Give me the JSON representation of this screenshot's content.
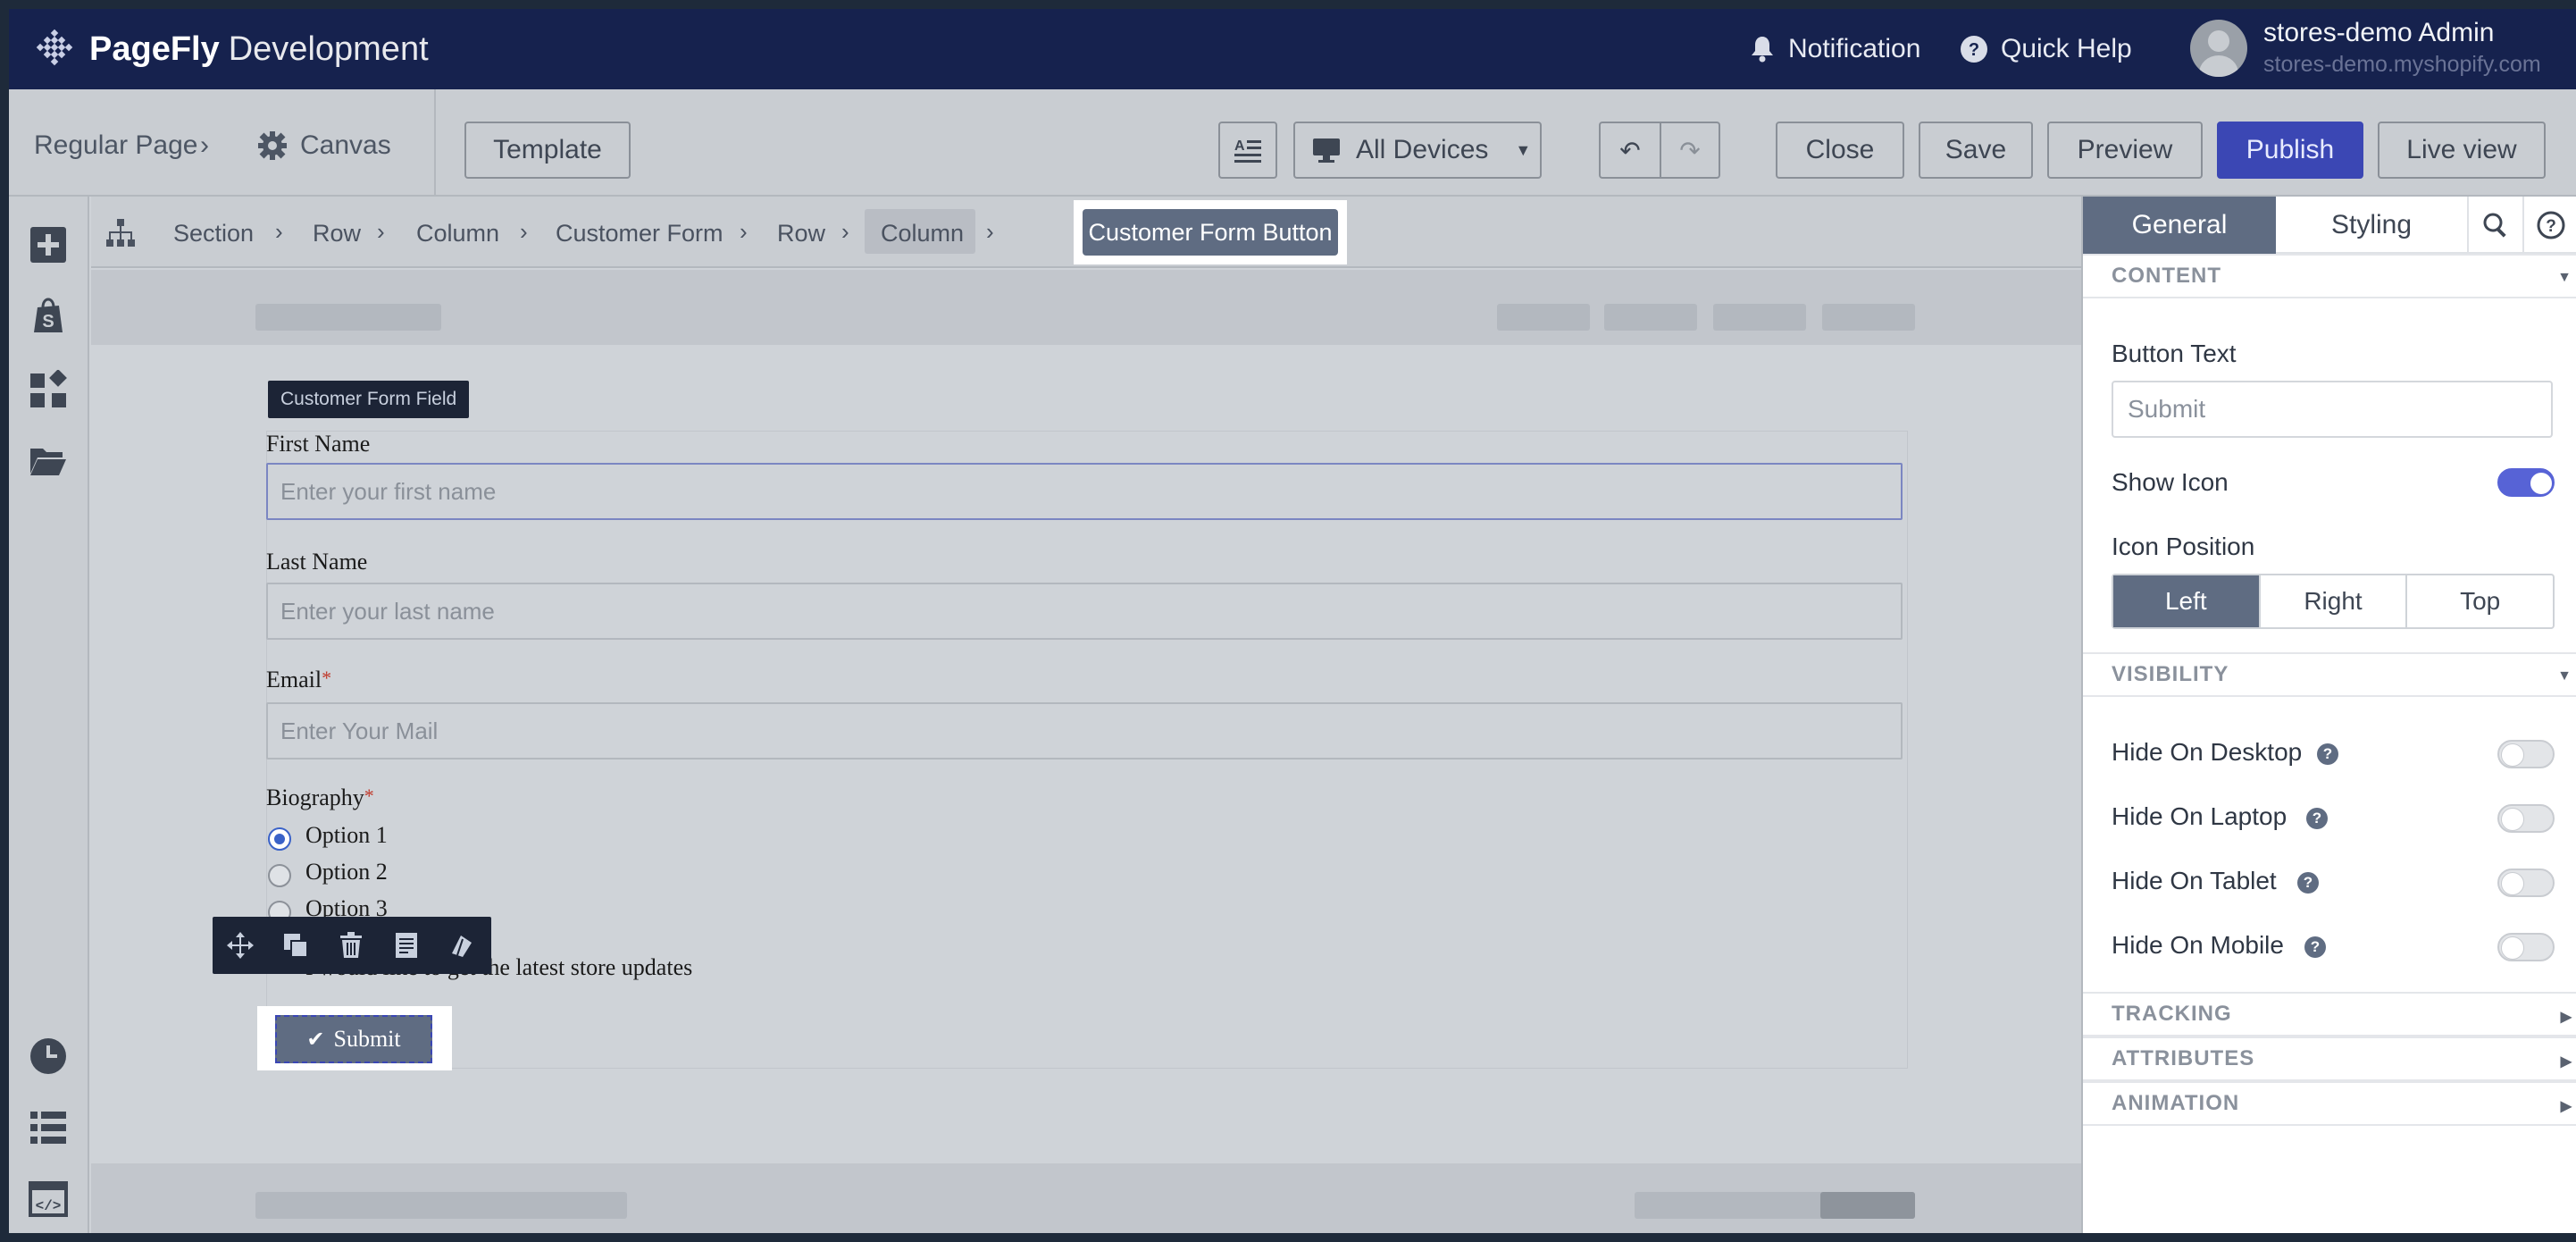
{
  "app": {
    "brand": "PageFly",
    "brand_suffix": "Development"
  },
  "topbar": {
    "notification_label": "Notification",
    "quick_help_label": "Quick Help",
    "user_name": "stores-demo Admin",
    "user_shop": "stores-demo.myshopify.com"
  },
  "toolbar": {
    "page_type": "Regular Page",
    "canvas_label": "Canvas",
    "template_label": "Template",
    "device_label": "All Devices",
    "close_label": "Close",
    "save_label": "Save",
    "preview_label": "Preview",
    "publish_label": "Publish",
    "live_view_label": "Live view"
  },
  "breadcrumb": {
    "items": [
      "Section",
      "Row",
      "Column",
      "Customer Form",
      "Row",
      "Column"
    ],
    "current": "Customer Form Button"
  },
  "form": {
    "tag_label": "Customer Form Field",
    "first_name_label": "First Name",
    "first_name_placeholder": "Enter your first name",
    "last_name_label": "Last Name",
    "last_name_placeholder": "Enter your last name",
    "email_label": "Email",
    "email_placeholder": "Enter Your Mail",
    "required_mark": "*",
    "biography_label": "Biography",
    "options": [
      "Option 1",
      "Option 2",
      "Option 3"
    ],
    "selected_option": "Option 1",
    "checkbox_label": "I would like to get the latest store updates",
    "submit_label": "Submit"
  },
  "panel": {
    "tabs": [
      "General",
      "Styling"
    ],
    "active_tab": "General",
    "content_header": "CONTENT",
    "button_text_label": "Button Text",
    "button_text_value": "Submit",
    "show_icon_label": "Show Icon",
    "show_icon_on": true,
    "icon_position_label": "Icon Position",
    "icon_positions": [
      "Left",
      "Right",
      "Top"
    ],
    "icon_position_selected": "Left",
    "visibility_header": "VISIBILITY",
    "visibility": [
      "Hide On Desktop",
      "Hide On Laptop",
      "Hide On Tablet",
      "Hide On Mobile"
    ],
    "tracking_header": "TRACKING",
    "attributes_header": "ATTRIBUTES",
    "animation_header": "ANIMATION",
    "help_mark": "?"
  },
  "colors": {
    "topbar": "#16224e",
    "publish": "#3b47b4",
    "accent": "#5763d6",
    "selected": "#5f6c82"
  }
}
